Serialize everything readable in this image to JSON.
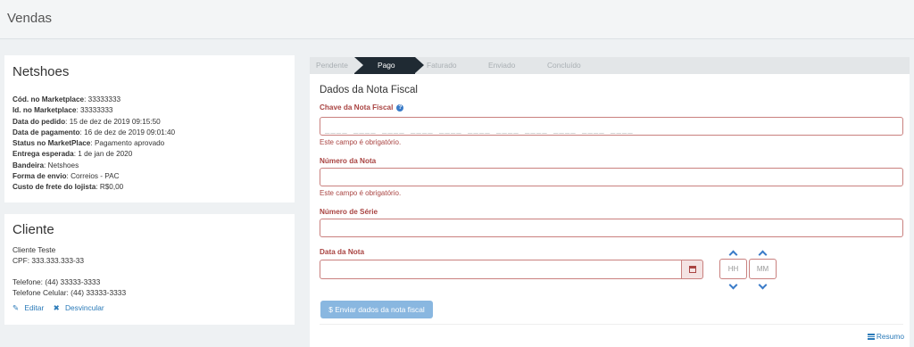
{
  "header": {
    "title": "Vendas"
  },
  "order": {
    "marketplace": "Netshoes",
    "fields": [
      {
        "label": "Cód. no Marketplace",
        "value": "33333333"
      },
      {
        "label": "Id. no Marketplace",
        "value": "33333333"
      },
      {
        "label": "Data do pedido",
        "value": "15 de dez de 2019 09:15:50"
      },
      {
        "label": "Data de pagamento",
        "value": "16 de dez de 2019 09:01:40"
      },
      {
        "label": "Status no MarketPlace",
        "value": "Pagamento aprovado"
      },
      {
        "label": "Entrega esperada",
        "value": "1 de jan de 2020"
      },
      {
        "label": "Bandeira",
        "value": "Netshoes"
      },
      {
        "label": "Forma de envio",
        "value": "Correios - PAC"
      },
      {
        "label": "Custo de frete do lojista",
        "value": "R$0,00"
      }
    ]
  },
  "client": {
    "title": "Cliente",
    "name": "Cliente Teste",
    "cpf": "CPF: 333.333.333-33",
    "phone": "Telefone: (44) 33333-3333",
    "mobile": "Telefone Celular: (44) 33333-3333",
    "edit_label": "Editar",
    "unlink_label": "Desvincular"
  },
  "steps": [
    "Pendente",
    "Pago",
    "Faturado",
    "Enviado",
    "Concluído"
  ],
  "active_step": "Pago",
  "invoice": {
    "title": "Dados da Nota Fiscal",
    "key_label": "Chave da Nota Fiscal",
    "key_mask": "____ ____ ____ ____ ____ ____ ____ ____ ____ ____ ____",
    "number_label": "Número da Nota",
    "series_label": "Número de Série",
    "date_label": "Data da Nota",
    "required_error": "Este campo é obrigatório.",
    "hour_placeholder": "HH",
    "minute_placeholder": "MM",
    "submit_label": "$ Enviar dados da nota fiscal",
    "summary_link": "Resumo"
  },
  "colors": {
    "error": "#a94442",
    "accent": "#3a7bc8",
    "active_step": "#1f2a33"
  }
}
